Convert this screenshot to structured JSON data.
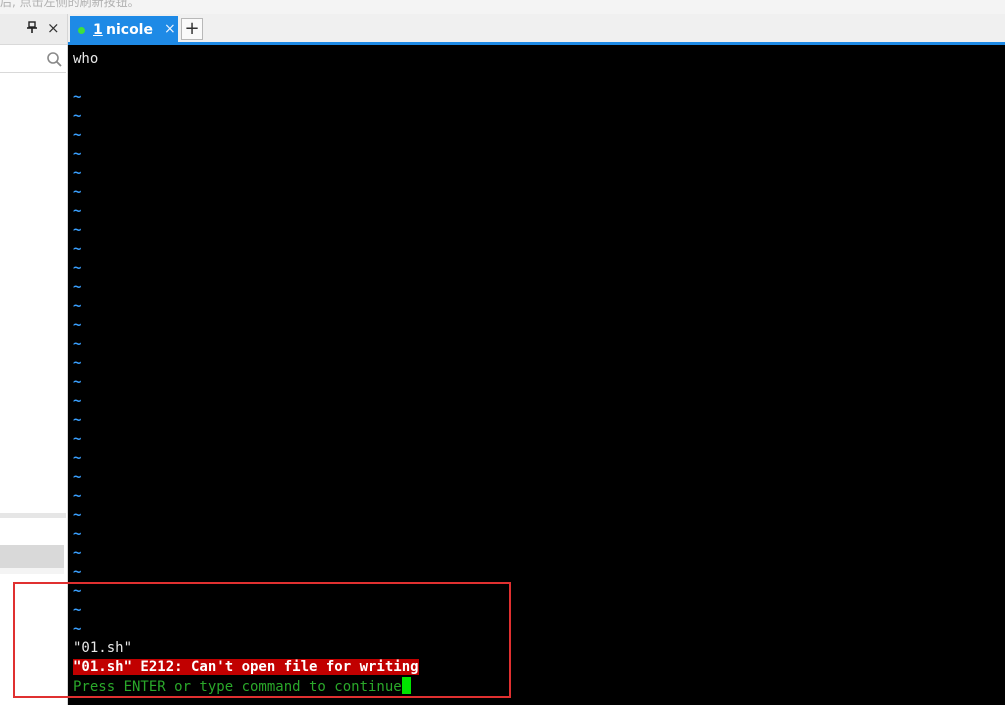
{
  "top_hint": "后, 点击左侧的刷新按钮。",
  "left_panel": {
    "pin_icon": "pin-icon",
    "close_label": "×",
    "search_icon": "search-icon"
  },
  "tab": {
    "status_color": "#3ee03e",
    "number": "1",
    "name": "nicole",
    "close_label": "×",
    "add_label": "+",
    "accent": "#1e8ae6"
  },
  "terminal": {
    "file_content": "who",
    "empty_line_marker": "~",
    "file_status": "\"01.sh\"",
    "error_message": "\"01.sh\" E212: Can't open file for writing",
    "prompt": "Press ENTER or type command to continue"
  },
  "colors": {
    "terminal_bg": "#000000",
    "tilde": "#3aa0ff",
    "error_bg": "#c10000",
    "prompt": "#2aa82a",
    "annotation": "#e03030"
  }
}
